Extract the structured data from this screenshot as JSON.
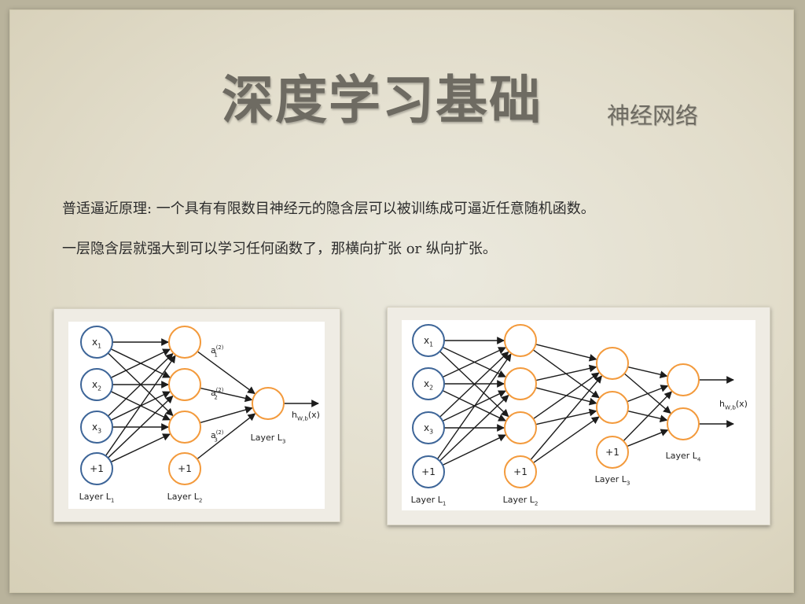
{
  "slide": {
    "title": "深度学习基础",
    "subtitle": "神经网络",
    "line1": "普适逼近原理: 一个具有有限数目神经元的隐含层可以被训练成可逼近任意随机函数。",
    "line2": "一层隐含层就强大到可以学习任何函数了，那横向扩张 or 纵向扩张。"
  },
  "diagram1": {
    "inputs": [
      {
        "base": "x",
        "sub": "1"
      },
      {
        "base": "x",
        "sub": "2"
      },
      {
        "base": "x",
        "sub": "3"
      },
      {
        "base": "+1",
        "sub": ""
      }
    ],
    "hidden": [
      {
        "base": "a",
        "sub": "1",
        "sup": "(2)"
      },
      {
        "base": "a",
        "sub": "2",
        "sup": "(2)"
      },
      {
        "base": "a",
        "sub": "3",
        "sup": "(2)"
      }
    ],
    "hidden_bias": "+1",
    "output_label": {
      "base": "h",
      "sub": "W,b",
      "tail": "(x)"
    },
    "layer_labels": [
      {
        "base": "Layer L",
        "sub": "1"
      },
      {
        "base": "Layer L",
        "sub": "2"
      },
      {
        "base": "Layer L",
        "sub": "3"
      }
    ],
    "colors": {
      "input": "#3d6598",
      "hidden": "#f39a3c",
      "edge": "#1c1c1c"
    }
  },
  "diagram2": {
    "inputs": [
      {
        "base": "x",
        "sub": "1"
      },
      {
        "base": "x",
        "sub": "2"
      },
      {
        "base": "x",
        "sub": "3"
      },
      {
        "base": "+1",
        "sub": ""
      }
    ],
    "hidden_bias_2": "+1",
    "hidden_bias_3": "+1",
    "output_label": {
      "base": "h",
      "sub": "W,b",
      "tail": "(x)"
    },
    "layer_labels": [
      {
        "base": "Layer L",
        "sub": "1"
      },
      {
        "base": "Layer L",
        "sub": "2"
      },
      {
        "base": "Layer L",
        "sub": "3"
      },
      {
        "base": "Layer L",
        "sub": "4"
      }
    ],
    "colors": {
      "input": "#3d6598",
      "hidden": "#f39a3c",
      "edge": "#1c1c1c"
    }
  }
}
